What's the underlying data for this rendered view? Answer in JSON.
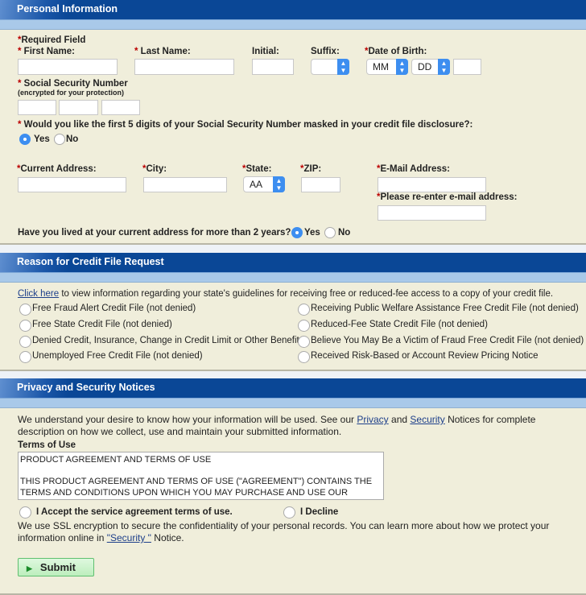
{
  "colors": {
    "header": "#0a4796",
    "strip": "#a9c9e9",
    "panel": "#f0eedb",
    "required": "#b00000",
    "submit": "#c9f0c9"
  },
  "personal": {
    "title": "Personal Information",
    "required_note": "Required Field",
    "first_name": "First Name:",
    "last_name": "Last Name:",
    "initial": "Initial:",
    "suffix": "Suffix:",
    "dob": "Date of Birth:",
    "dob_month": "MM",
    "dob_day": "DD",
    "suffix_value": "",
    "ssn": "Social Security Number",
    "ssn_note": "(encrypted for your protection)",
    "mask_question": "Would you like the first 5 digits of your Social Security Number masked in your credit file disclosure?:",
    "mask_yes": "Yes",
    "mask_no": "No",
    "mask_selected": "Yes",
    "address": "Current Address:",
    "city": "City:",
    "state": "State:",
    "state_value": "AA",
    "zip": "ZIP:",
    "email": "E-Mail Address:",
    "email_confirm": "Please re-enter e-mail address:",
    "lived_question": "Have you lived at your current address for more than 2 years?",
    "lived_yes": "Yes",
    "lived_no": "No",
    "lived_selected": "Yes"
  },
  "reason": {
    "title": "Reason for Credit File Request",
    "link": "Click here",
    "intro": " to view information regarding your state's guidelines for receiving free or reduced-fee access to a copy of your credit file.",
    "options_left": [
      "Free Fraud Alert Credit File (not denied)",
      "Free State Credit File (not denied)",
      "Denied Credit, Insurance, Change in Credit Limit or Other Benefit",
      "Unemployed Free Credit File (not denied)"
    ],
    "options_right": [
      "Receiving Public Welfare Assistance Free Credit File (not denied)",
      "Reduced-Fee State Credit File (not denied)",
      "Believe You May Be a Victim of Fraud Free Credit File (not denied)",
      "Received Risk-Based or Account Review Pricing Notice"
    ]
  },
  "privacy": {
    "title": "Privacy and Security Notices",
    "text1a": "We understand your desire to know how your information will be used. See our ",
    "privacy_link": "Privacy",
    "text1b": " and ",
    "security_link": "Security",
    "text1c": " Notices for complete",
    "text2": "description on how we collect, use and maintain your submitted information.",
    "terms_label": "Terms of Use",
    "terms_text": "PRODUCT AGREEMENT AND TERMS OF USE\n\nTHIS PRODUCT AGREEMENT AND TERMS OF USE (\"AGREEMENT\") CONTAINS THE TERMS AND CONDITIONS UPON WHICH YOU MAY PURCHASE AND USE OUR",
    "accept": "I Accept the service agreement terms of use.",
    "decline": "I Decline",
    "ssl1": "We use SSL encryption to secure the confidentiality of your personal records. You can learn more about how we protect your",
    "ssl2a": "information online in ",
    "ssl_link": "\"Security \"",
    "ssl2b": " Notice.",
    "submit": "Submit"
  }
}
